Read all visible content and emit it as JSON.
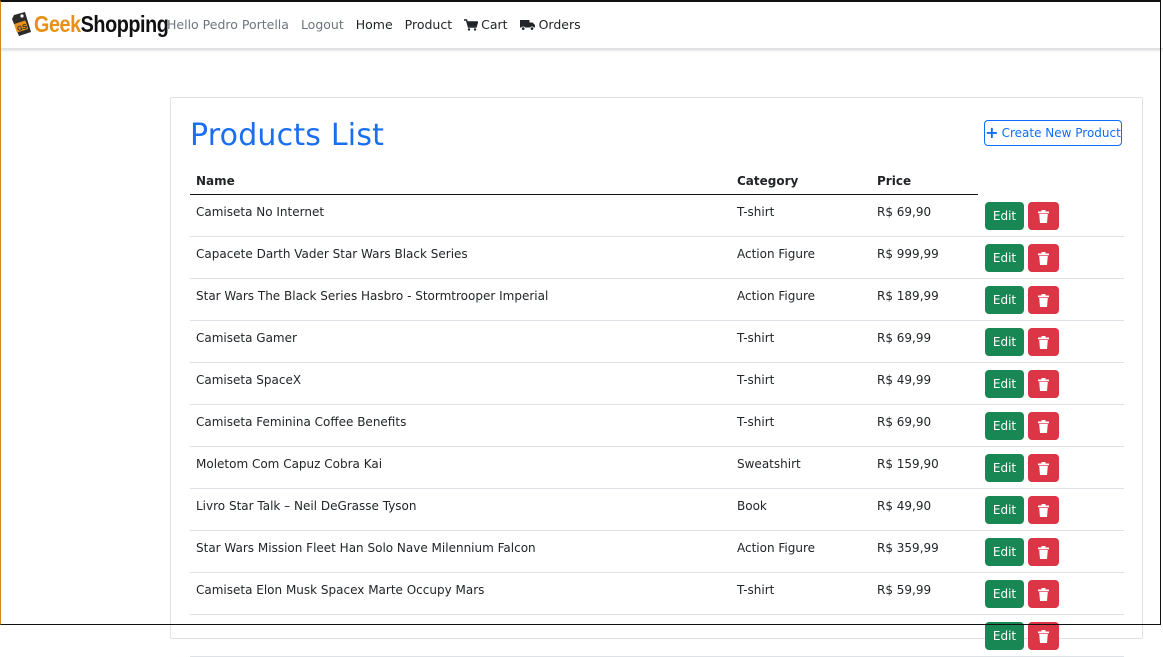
{
  "brand": {
    "geek": "Geek",
    "shopping": "Shopping",
    "logo_icon": "price-tag-gs-icon"
  },
  "nav": {
    "greeting": "Hello Pedro Portella",
    "logout": "Logout",
    "home": "Home",
    "product": "Product",
    "cart": "Cart",
    "orders": "Orders"
  },
  "page": {
    "title": "Products List",
    "create_button": "Create New Product"
  },
  "table": {
    "columns": [
      "Name",
      "Category",
      "Price"
    ],
    "edit_label": "Edit",
    "rows": [
      {
        "name": "Camiseta No Internet",
        "category": "T-shirt",
        "price": "R$ 69,90"
      },
      {
        "name": "Capacete Darth Vader Star Wars Black Series",
        "category": "Action Figure",
        "price": "R$ 999,99"
      },
      {
        "name": "Star Wars The Black Series Hasbro - Stormtrooper Imperial",
        "category": "Action Figure",
        "price": "R$ 189,99"
      },
      {
        "name": "Camiseta Gamer",
        "category": "T-shirt",
        "price": "R$ 69,99"
      },
      {
        "name": "Camiseta SpaceX",
        "category": "T-shirt",
        "price": "R$ 49,99"
      },
      {
        "name": "Camiseta Feminina Coffee Benefits",
        "category": "T-shirt",
        "price": "R$ 69,90"
      },
      {
        "name": "Moletom Com Capuz Cobra Kai",
        "category": "Sweatshirt",
        "price": "R$ 159,90"
      },
      {
        "name": "Livro Star Talk – Neil DeGrasse Tyson",
        "category": "Book",
        "price": "R$ 49,90"
      },
      {
        "name": "Star Wars Mission Fleet Han Solo Nave Milennium Falcon",
        "category": "Action Figure",
        "price": "R$ 359,99"
      },
      {
        "name": "Camiseta Elon Musk Spacex Marte Occupy Mars",
        "category": "T-shirt",
        "price": "R$ 59,99"
      },
      {
        "name": "",
        "category": "",
        "price": ""
      }
    ]
  },
  "colors": {
    "accent": "#1a6ff1",
    "edit": "#198754",
    "delete": "#dc3545",
    "brand_orange": "#e8901a"
  }
}
